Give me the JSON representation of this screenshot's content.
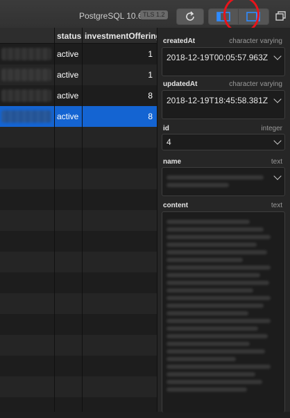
{
  "toolbar": {
    "connection": "PostgreSQL 10.6",
    "tls": "TLS 1.2"
  },
  "grid": {
    "columns": [
      "status",
      "investmentOffering"
    ],
    "rows": [
      {
        "status": "active",
        "investmentOffering": "1"
      },
      {
        "status": "active",
        "investmentOffering": "1"
      },
      {
        "status": "active",
        "investmentOffering": "8"
      },
      {
        "status": "active",
        "investmentOffering": "8"
      }
    ]
  },
  "detail": {
    "createdAt": {
      "label": "createdAt",
      "type": "character varying",
      "value": "2018-12-19T00:05:57.963Z"
    },
    "updatedAt": {
      "label": "updatedAt",
      "type": "character varying",
      "value": "2018-12-19T18:45:58.381Z"
    },
    "id": {
      "label": "id",
      "type": "integer",
      "value": "4"
    },
    "name": {
      "label": "name",
      "type": "text"
    },
    "content": {
      "label": "content",
      "type": "text"
    }
  }
}
